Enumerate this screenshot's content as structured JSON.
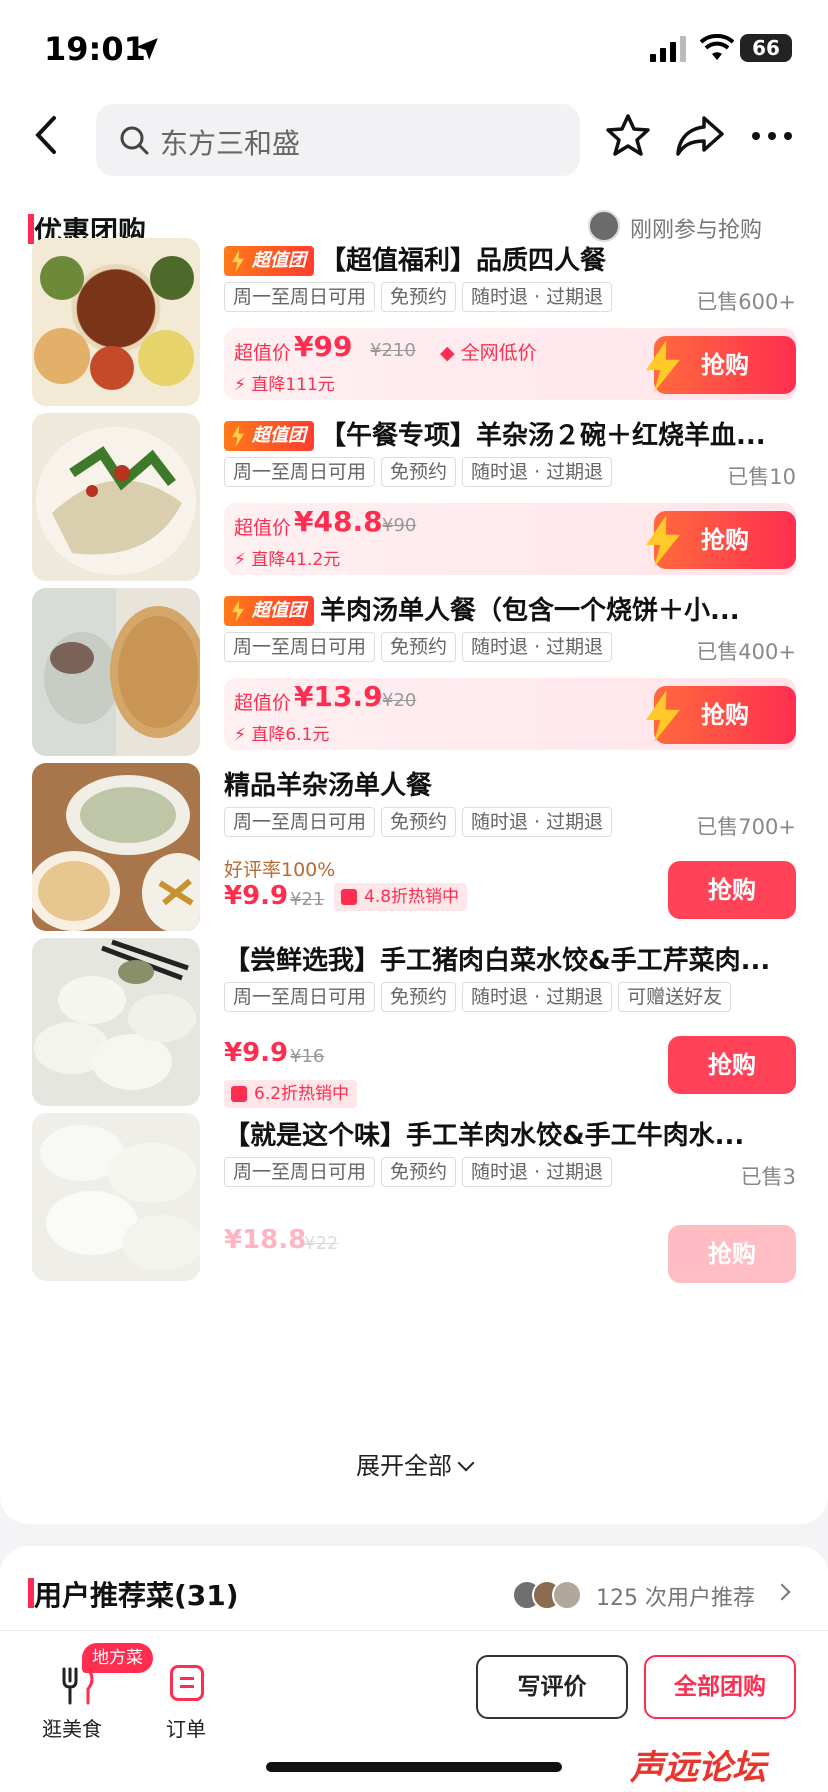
{
  "status_bar": {
    "time": "19:01",
    "battery": "66"
  },
  "search": {
    "query": "东方三和盛"
  },
  "deals_section": {
    "title": "优惠团购",
    "recent_text": "刚刚参与抢购",
    "badge_text": "超值团",
    "tags_common": [
      "周一至周日可用",
      "免预约",
      "随时退 · 过期退"
    ],
    "grab_label": "抢购",
    "expand_label": "展开全部",
    "items": [
      {
        "title": "【超值福利】品质四人餐",
        "sold": "已售600+",
        "price_label": "超值价",
        "price": "¥99",
        "orig": "¥210",
        "extra": "全网低价",
        "drop": "直降111元"
      },
      {
        "title": "【午餐专项】羊杂汤２碗＋红烧羊血...",
        "sold": "已售10",
        "price_label": "超值价",
        "price": "¥48.8",
        "orig": "¥90",
        "drop": "直降41.2元"
      },
      {
        "title": "羊肉汤单人餐（包含一个烧饼＋小...",
        "sold": "已售400+",
        "price_label": "超值价",
        "price": "¥13.9",
        "orig": "¥20",
        "drop": "直降6.1元"
      },
      {
        "title": "精品羊杂汤单人餐",
        "sold": "已售700+",
        "good_rate": "好评率100%",
        "price": "¥9.9",
        "orig": "¥21",
        "hot": "4.8折热销中"
      },
      {
        "title": "【尝鲜选我】手工猪肉白菜水饺&手工芹菜肉...",
        "extra_tag": "可赠送好友",
        "price": "¥9.9",
        "orig": "¥16",
        "hot": "6.2折热销中"
      },
      {
        "title": "【就是这个味】手工羊肉水饺&手工牛肉水...",
        "sold": "已售3",
        "price": "¥18.8",
        "orig": "¥22"
      }
    ]
  },
  "recommend": {
    "title": "用户推荐菜(31)",
    "count_text": "125 次用户推荐"
  },
  "bottom_bar": {
    "tab_food": "逛美食",
    "local_badge": "地方菜",
    "tab_order": "订单",
    "write_review": "写评价",
    "all_deals": "全部团购"
  },
  "watermark": "声远论坛",
  "colors": {
    "accent": "#ff2e50",
    "badge_orange": "#ff7a1a"
  }
}
